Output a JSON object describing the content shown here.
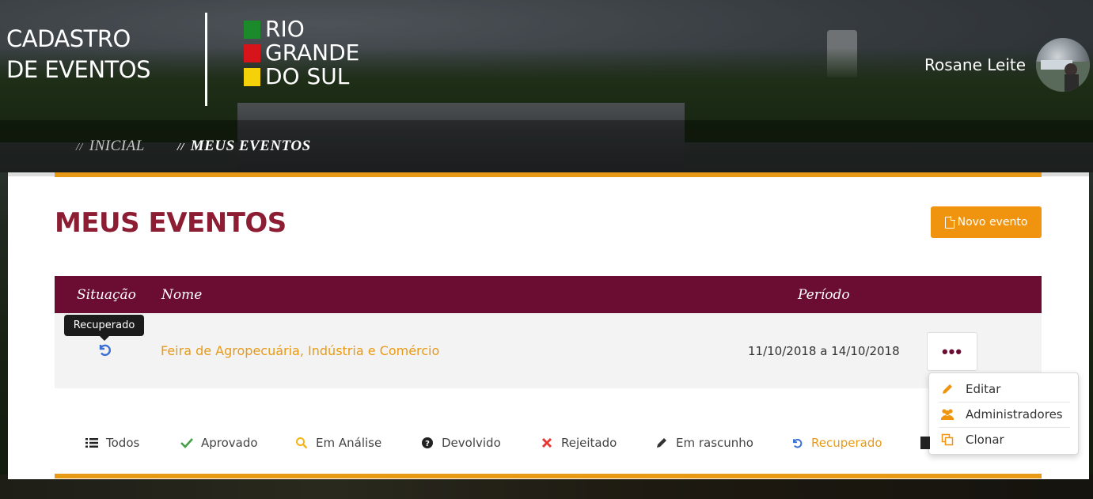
{
  "header": {
    "brand_line1": "CADASTRO",
    "brand_line2": "DE EVENTOS",
    "logo_lines": [
      "RIO",
      "GRANDE",
      "DO SUL"
    ],
    "logo_colors": [
      "#1a8a2a",
      "#d7141a",
      "#f5d10a"
    ],
    "user_name": "Rosane Leite"
  },
  "breadcrumb": {
    "items": [
      "INICIAL",
      "MEUS EVENTOS"
    ],
    "separator": "//"
  },
  "page": {
    "title": "MEUS EVENTOS",
    "new_button_label": "Novo evento"
  },
  "table": {
    "columns": [
      "Situação",
      "Nome",
      "Período"
    ],
    "rows": [
      {
        "status_icon": "recovered-icon",
        "status_tooltip": "Recuperado",
        "name": "Feira de Agropecuária, Indústria e Comércio",
        "period": "11/10/2018 a 14/10/2018",
        "actions_label": "•••"
      }
    ]
  },
  "actions_menu": {
    "items": [
      {
        "label": "Editar",
        "icon": "pencil-icon"
      },
      {
        "label": "Administradores",
        "icon": "users-icon"
      },
      {
        "label": "Clonar",
        "icon": "clone-icon"
      }
    ]
  },
  "filters": [
    {
      "label": "Todos",
      "icon": "list-icon",
      "active": false
    },
    {
      "label": "Aprovado",
      "icon": "check-icon",
      "active": false
    },
    {
      "label": "Em Análise",
      "icon": "search-icon",
      "active": false
    },
    {
      "label": "Devolvido",
      "icon": "question-icon",
      "active": false
    },
    {
      "label": "Rejeitado",
      "icon": "x-icon",
      "active": false
    },
    {
      "label": "Em rascunho",
      "icon": "pencil-icon",
      "active": false
    },
    {
      "label": "Recuperado",
      "icon": "recovered-icon",
      "active": true
    }
  ],
  "colors": {
    "accent_orange": "#f0930f",
    "brand_maroon": "#6b0d33",
    "title_red": "#8c1d33",
    "link_orange": "#e89a16",
    "status_blue": "#3a6fd6"
  }
}
